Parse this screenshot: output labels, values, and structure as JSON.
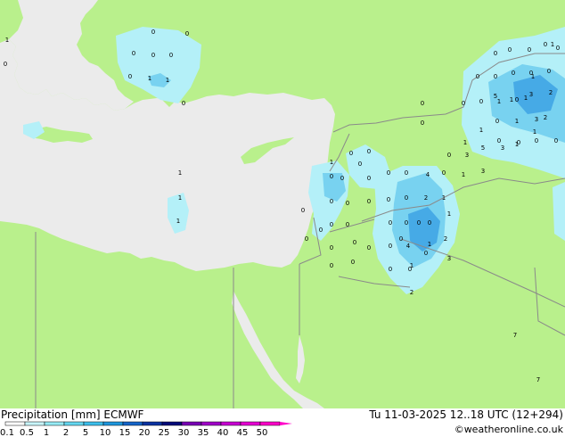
{
  "header": {
    "title": "Precipitation [mm] ECMWF",
    "valid_time": "Tu 11-03-2025 12..18 UTC (12+294)",
    "copyright": "©weatheronline.co.uk"
  },
  "legend": {
    "ticks": [
      "0.1",
      "0.5",
      "1",
      "2",
      "5",
      "10",
      "15",
      "20",
      "25",
      "30",
      "35",
      "40",
      "45",
      "50"
    ],
    "colors": [
      "#ffffff",
      "#c8f5fa",
      "#96ebf5",
      "#64d7f0",
      "#3cbeeb",
      "#1e96dc",
      "#1464c8",
      "#0a32a0",
      "#000a78",
      "#7800b4",
      "#a000c8",
      "#c800d2",
      "#e600d2",
      "#ff00c8"
    ]
  },
  "colors": {
    "land": "#b9f08c",
    "sea": "#ebebeb",
    "border": "#8a8a8a",
    "precip_light": "#b4f0f8",
    "precip_medium": "#78d2f0",
    "precip_heavy": "#46aae6"
  },
  "value_labels": [
    "0",
    "1",
    "0",
    "0",
    "0",
    "0",
    "0",
    "1",
    "0",
    "1",
    "0",
    "1",
    "1",
    "1",
    "0",
    "0",
    "4",
    "0",
    "0",
    "0",
    "0",
    "0",
    "0",
    "0",
    "0",
    "0",
    "0",
    "0",
    "0",
    "0",
    "0",
    "0",
    "0",
    "0",
    "0",
    "0",
    "0",
    "0",
    "0",
    "2",
    "0",
    "1",
    "0",
    "0",
    "1",
    "4",
    "2",
    "0",
    "3",
    "1",
    "3",
    "5",
    "3",
    "1",
    "0",
    "3",
    "2",
    "3",
    "1",
    "0",
    "1",
    "0",
    "0",
    "0",
    "0",
    "0",
    "0",
    "0",
    "0",
    "1",
    "2",
    "0",
    "0",
    "0",
    "1",
    "1",
    "5",
    "7",
    "7",
    "1",
    "1",
    "2",
    "1",
    "1",
    "0",
    "1",
    "0",
    "1",
    "3",
    "1",
    "0",
    "0",
    "0",
    "0",
    "0",
    "0",
    "0",
    "0",
    "0",
    "0",
    "0"
  ]
}
